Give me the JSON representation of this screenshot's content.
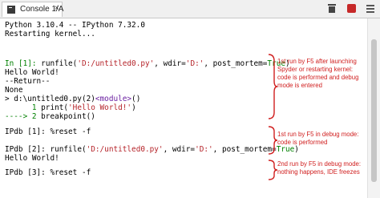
{
  "tab": {
    "label": "Console 1/A",
    "close": "×"
  },
  "console": {
    "header": [
      "Python 3.10.4 -- IPython 7.32.0",
      "Restarting kernel..."
    ],
    "in1": {
      "prompt": "In [",
      "num": "1",
      "prompt_end": "]: ",
      "cmd": "runfile(",
      "arg1": "'D:/untitled0.py'",
      "mid": ", wdir=",
      "arg2": "'D:'",
      "mid2": ", post_mortem=",
      "val": "True",
      "end": ")"
    },
    "out1": [
      "Hello World!",
      "--Return--",
      "None"
    ],
    "trace": {
      "prefix": "> d:\\untitled0.py(2)",
      "module": "<module>",
      "suffix": "()"
    },
    "src1": {
      "num": "      1 ",
      "call": "print(",
      "str": "'Hello World!'",
      "end": ")"
    },
    "src2": {
      "arrow": "----> 2 ",
      "call": "breakpoint()"
    },
    "ipdb1": "IPdb [1]: %reset -f",
    "ipdb2": {
      "prompt": "IPdb [2]: ",
      "cmd": "runfile(",
      "arg1": "'D:/untitled0.py'",
      "mid": ", wdir=",
      "arg2": "'D:'",
      "mid2": ", post_mortem=",
      "val": "True",
      "end": ")"
    },
    "out2": "Hello World!",
    "ipdb3": {
      "prompt": "IPdb [3]: ",
      "cmd": "%reset -f"
    }
  },
  "annotations": [
    {
      "lines": [
        "1st run by F5 after launching",
        "Spyder or restarting kernel:",
        "code is performed and debug",
        "mode is entered"
      ]
    },
    {
      "lines": [
        "1st run by F5 in debug mode:",
        "code is performed"
      ]
    },
    {
      "lines": [
        "2nd run by F5 in debug mode:",
        "nothing happens, IDE freezes"
      ]
    }
  ],
  "colors": {
    "annotation": "#d01e1e",
    "keyword": "#008000",
    "string": "#b5242a",
    "module": "#6a1fa0",
    "stop": "#c62828"
  },
  "icons": {
    "tab": "console-icon",
    "clear": "trash-icon",
    "stop": "stop-icon",
    "options": "hamburger-menu-icon"
  }
}
